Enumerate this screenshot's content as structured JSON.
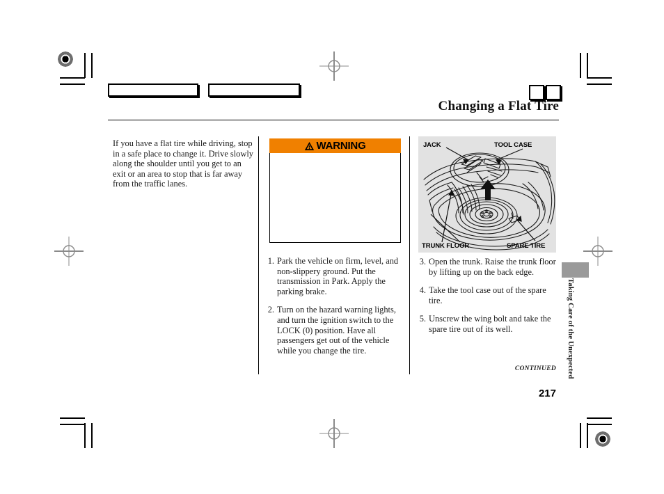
{
  "document": {
    "title": "Changing a Flat Tire",
    "page_number": "217",
    "continued_label": "CONTINUED",
    "side_tab_label": "Taking Care of the Unexpected"
  },
  "left_column": {
    "intro_paragraph": "If you have a flat tire while driving, stop in a safe place to change it. Drive slowly along the shoulder until you get to an exit or an area to stop that is far away from the traffic lanes."
  },
  "middle_column": {
    "warning": {
      "label": "WARNING",
      "icon": "warning-triangle-icon",
      "banner_color": "#F08000",
      "body_text": ""
    },
    "steps": [
      {
        "number": "1.",
        "text": "Park the vehicle on firm, level, and non-slippery ground. Put the transmission in Park. Apply the parking brake."
      },
      {
        "number": "2.",
        "text": "Turn on the hazard warning lights, and turn the ignition switch to the LOCK (0) position. Have all passengers get out of the vehicle while you change the tire."
      }
    ]
  },
  "right_column": {
    "illustration": {
      "name": "trunk-spare-tire-diagram",
      "background_color": "#E2E2E2",
      "labels": [
        {
          "text": "JACK",
          "position": "top-left"
        },
        {
          "text": "TOOL CASE",
          "position": "top-right"
        },
        {
          "text": "TRUNK FLOOR",
          "position": "bottom-left"
        },
        {
          "text": "SPARE TIRE",
          "position": "bottom-right"
        }
      ]
    },
    "steps": [
      {
        "number": "3.",
        "text": "Open the trunk. Raise the trunk floor by lifting up on the back edge."
      },
      {
        "number": "4.",
        "text": "Take the tool case out of the spare tire."
      },
      {
        "number": "5.",
        "text": "Unscrew the wing bolt and take the spare tire out of its well."
      }
    ]
  },
  "print_marks": {
    "color_bar_1": "",
    "color_bar_2": "",
    "mini_box_1": "",
    "mini_box_2": ""
  }
}
